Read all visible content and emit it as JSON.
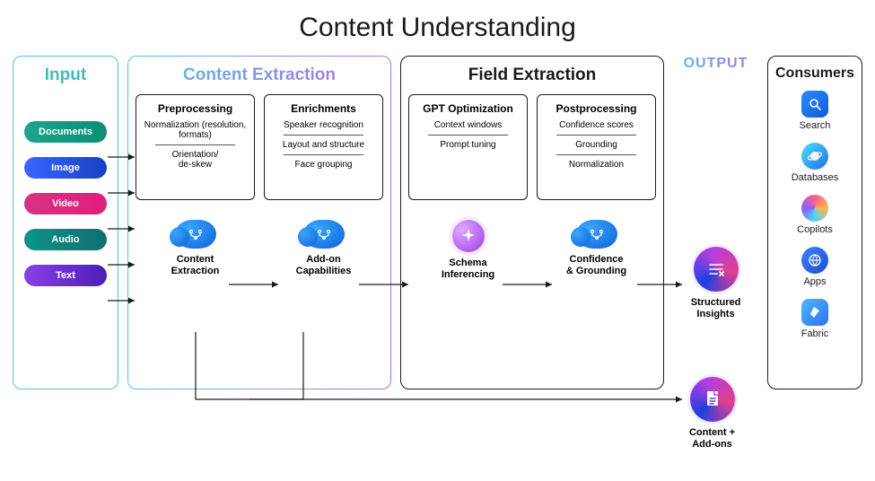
{
  "title": "Content Understanding",
  "input": {
    "title": "Input",
    "items": [
      "Documents",
      "Image",
      "Video",
      "Audio",
      "Text"
    ]
  },
  "content_extraction": {
    "title": "Content Extraction",
    "preprocessing": {
      "title": "Preprocessing",
      "lines": [
        "Normalization (resolution, formats)",
        "Orientation/\nde-skew"
      ]
    },
    "enrichments": {
      "title": "Enrichments",
      "lines": [
        "Speaker recognition",
        "Layout and structure",
        "Face grouping"
      ]
    },
    "nodes": {
      "content_extraction": "Content\nExtraction",
      "addon_capabilities": "Add-on\nCapabilities"
    }
  },
  "field_extraction": {
    "title": "Field Extraction",
    "gpt_optimization": {
      "title": "GPT Optimization",
      "lines": [
        "Context windows",
        "Prompt tuning"
      ]
    },
    "postprocessing": {
      "title": "Postprocessing",
      "lines": [
        "Confidence scores",
        "Grounding",
        "Normalization"
      ]
    },
    "nodes": {
      "schema_inferencing": "Schema\nInferencing",
      "confidence_grounding": "Confidence\n& Grounding"
    }
  },
  "output": {
    "title": "OUTPUT",
    "structured": "Structured\nInsights",
    "content_addons": "Content +\nAdd-ons"
  },
  "consumers": {
    "title": "Consumers",
    "items": [
      "Search",
      "Databases",
      "Copilots",
      "Apps",
      "Fabric"
    ]
  }
}
